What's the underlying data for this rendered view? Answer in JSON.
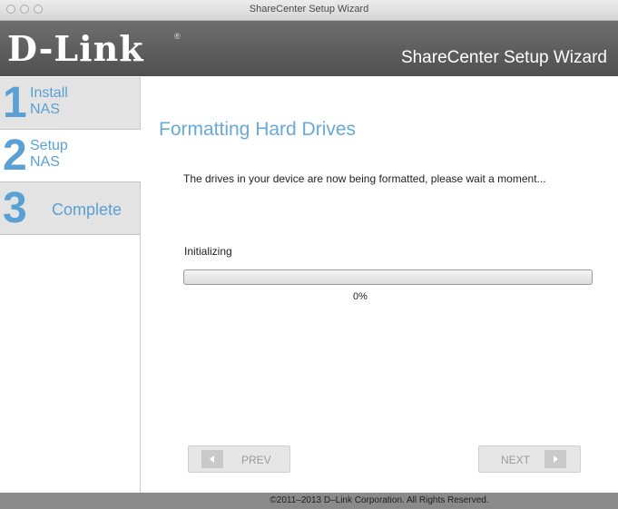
{
  "window": {
    "title": "ShareCenter Setup Wizard"
  },
  "header": {
    "logo": "D-Link",
    "logo_mark": "®",
    "title": "ShareCenter Setup Wizard"
  },
  "sidebar": {
    "steps": [
      {
        "number": "1",
        "label": "Install\nNAS"
      },
      {
        "number": "2",
        "label": "Setup\nNAS"
      },
      {
        "number": "3",
        "label": "Complete"
      }
    ]
  },
  "main": {
    "title": "Formatting Hard Drives",
    "message": "The drives in your device are now being formatted, please wait a moment...",
    "status_label": "Initializing",
    "progress_percent": 0,
    "progress_text": "0%"
  },
  "buttons": {
    "prev": "PREV",
    "next": "NEXT"
  },
  "footer": {
    "copyright": "©2011–2013 D–Link Corporation. All Rights Reserved."
  },
  "colors": {
    "accent": "#5aa0d4",
    "header_bg": "#5e5e5e",
    "footer_bg": "#8a8a8a"
  }
}
